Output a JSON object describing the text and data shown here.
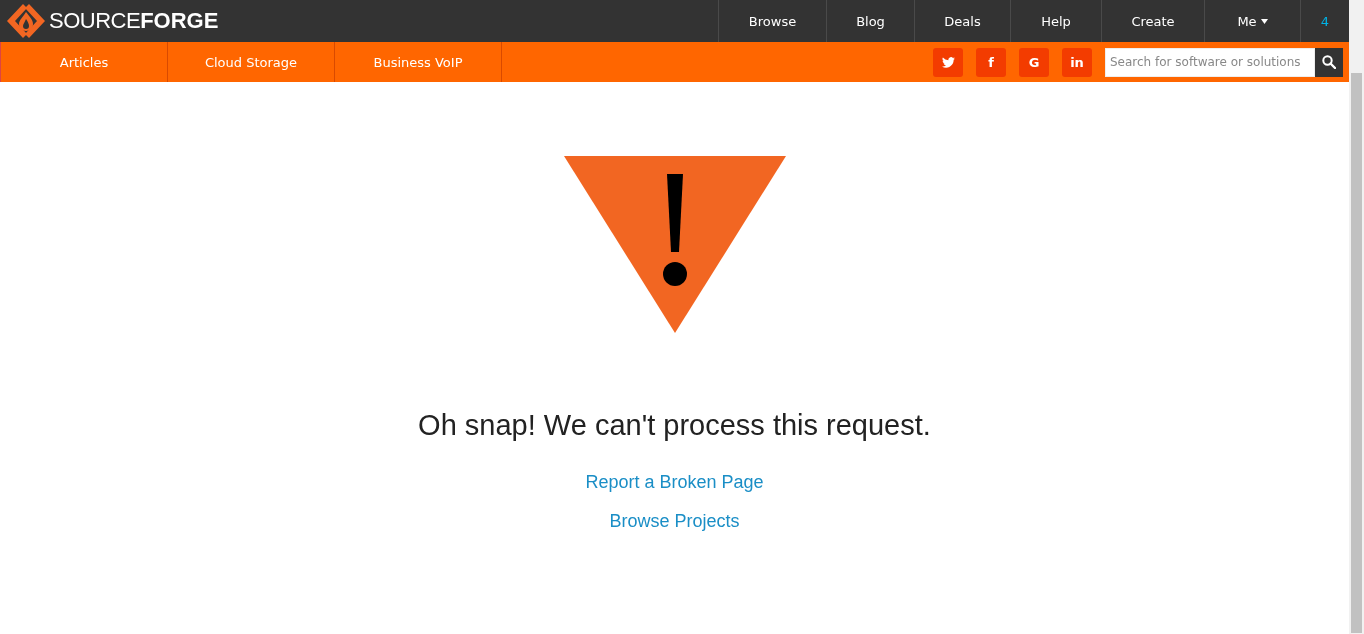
{
  "header": {
    "brand_light": "SOURCE",
    "brand_bold": "FORGE",
    "nav": [
      {
        "label": "Browse"
      },
      {
        "label": "Blog"
      },
      {
        "label": "Deals"
      },
      {
        "label": "Help"
      },
      {
        "label": "Create"
      },
      {
        "label": "Me",
        "dropdown": true
      },
      {
        "label": "4",
        "kind": "count"
      }
    ]
  },
  "subnav": {
    "items": [
      {
        "label": "Articles"
      },
      {
        "label": "Cloud Storage"
      },
      {
        "label": "Business VoIP"
      }
    ],
    "social": [
      {
        "kind": "bird"
      },
      {
        "kind": "letter",
        "label": "f"
      },
      {
        "kind": "letter",
        "label": "G"
      },
      {
        "kind": "letter",
        "label": "in"
      }
    ],
    "search": {
      "placeholder": "Search for software or solutions"
    }
  },
  "error": {
    "message": "Oh snap! We can't process this request.",
    "links": [
      "Report a Broken Page",
      "Browse Projects"
    ]
  }
}
